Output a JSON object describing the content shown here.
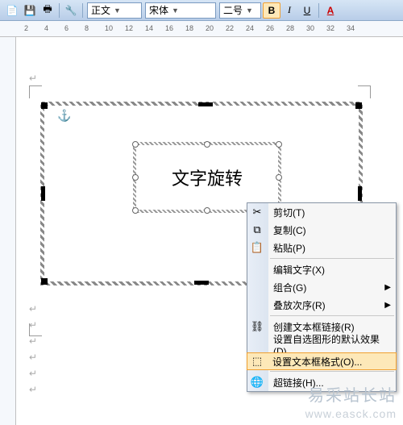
{
  "toolbar": {
    "style_label": "正文",
    "font_label": "宋体",
    "size_label": "二号",
    "bold": "B",
    "italic": "I",
    "underline": "U",
    "fontcolor": "A"
  },
  "ruler": {
    "ticks": [
      "2",
      "4",
      "6",
      "8",
      "10",
      "12",
      "14",
      "16",
      "18",
      "20",
      "22",
      "24",
      "26",
      "28",
      "30",
      "32",
      "34"
    ]
  },
  "textbox": {
    "content": "文字旋转"
  },
  "context_menu": {
    "cut": "剪切(T)",
    "copy": "复制(C)",
    "paste": "粘贴(P)",
    "edit_text": "编辑文字(X)",
    "group": "组合(G)",
    "order": "叠放次序(R)",
    "create_link": "创建文本框链接(R)",
    "set_autoshape": "设置自选图形的默认效果(D)",
    "format_textbox": "设置文本框格式(O)...",
    "hyperlink": "超链接(H)..."
  },
  "watermark": {
    "line1": "易采站长站",
    "line2": "www.easck.com"
  }
}
